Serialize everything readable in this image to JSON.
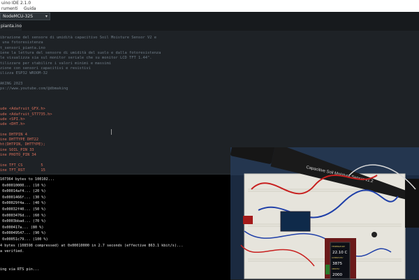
{
  "window": {
    "title": "uino IDE 2.1.0"
  },
  "menu": {
    "items": [
      "rumenti",
      "Guida"
    ]
  },
  "toolbar": {
    "board": "NodeMCU-32S"
  },
  "tabs": [
    {
      "label": "pianta.ino"
    }
  ],
  "editor": {
    "lines": [
      {
        "cls": "cmt",
        "text": "ibrazione del sensore di umidità capacitivo Soil Moisture Sensor V2 e"
      },
      {
        "cls": "cmt",
        "text": " una fotoresistenza"
      },
      {
        "cls": "cmt",
        "text": "t_sensori_pianta.ino"
      },
      {
        "cls": "cmt",
        "text": "iene la lettura del sensore di umidità del suolo e dalla fotoresistenza"
      },
      {
        "cls": "cmt",
        "text": "le visualizza sia sul monitor seriale che su monitor LCD TFT 1.44\"."
      },
      {
        "cls": "cmt",
        "text": "tilizzare per stabilire i valori minimi e massimi"
      },
      {
        "cls": "cmt",
        "text": "zione con sensori capacitivi e resistivi"
      },
      {
        "cls": "cmt",
        "text": "ilizza ESP32 WROOM-32"
      },
      {
        "cls": "cmt",
        "text": ""
      },
      {
        "cls": "cmt",
        "text": "AKING 2023"
      },
      {
        "cls": "cmt",
        "text": "ps://www.youtube.com/@dbmaking"
      },
      {
        "cls": "cmt",
        "text": ""
      },
      {
        "cls": "cmt",
        "text": ""
      },
      {
        "cls": "cmt",
        "text": ""
      },
      {
        "cls": "inc",
        "text": "ude <Adafruit_GFX.h>"
      },
      {
        "cls": "inc",
        "text": "ude <Adafruit_ST7735.h>"
      },
      {
        "cls": "inc",
        "text": "ude <SPI.h>"
      },
      {
        "cls": "inc",
        "text": "ude <DHT.h>"
      },
      {
        "cls": "cmt",
        "text": ""
      },
      {
        "cls": "def",
        "text": "ine DHTPIN 4"
      },
      {
        "cls": "def",
        "text": "ine DHTTYPE DHT22"
      },
      {
        "cls": "def",
        "text": "ht(DHTPIN, DHTTYPE);"
      },
      {
        "cls": "def",
        "text": "ine SOIL_PIN 33"
      },
      {
        "cls": "def",
        "text": "ine PHOTO_PIN 34"
      },
      {
        "cls": "cmt",
        "text": ""
      },
      {
        "cls": "def",
        "text": "ine TFT_CS        5"
      },
      {
        "cls": "def",
        "text": "ine TFT_RST       15"
      }
    ]
  },
  "console": {
    "lines": [
      "107364 bytes to 100102...",
      " 0x00010000... (10 %)",
      " 0x00014af4... (20 %)",
      " 0x0001466f... (30 %)",
      " 0x00029f4a... (40 %)",
      " 0x00032f40... (50 %)",
      " 0x0003476d... (60 %)",
      " 0x0003bbad... (70 %)",
      " 0x000417a... (80 %)",
      " 0x00049547... (90 %)",
      " 0x00051c79... (100 %)",
      "4 bytes (108598 compressed) at 0x00010000 in 2.7 seconds (effective 863.1 kbit/s)...",
      "a verified.",
      "",
      "",
      "ing via RTS pin..."
    ]
  },
  "photo": {
    "sensor_label": "Capacitive Soil Moisture Sensor v1.2",
    "tft_lines": [
      "TEMPERATURE",
      "22.10 C",
      "LUMINOSITA'",
      "3875",
      "UMIDITA'",
      "2000"
    ],
    "colors": {
      "breadboard": "#e8e6df",
      "sensor": "#1a1a1a",
      "wire_red": "#c8201f",
      "wire_blue": "#1f3fa8",
      "tft_bg": "#0d0f16",
      "tft_accent": "#ffe36a"
    }
  }
}
